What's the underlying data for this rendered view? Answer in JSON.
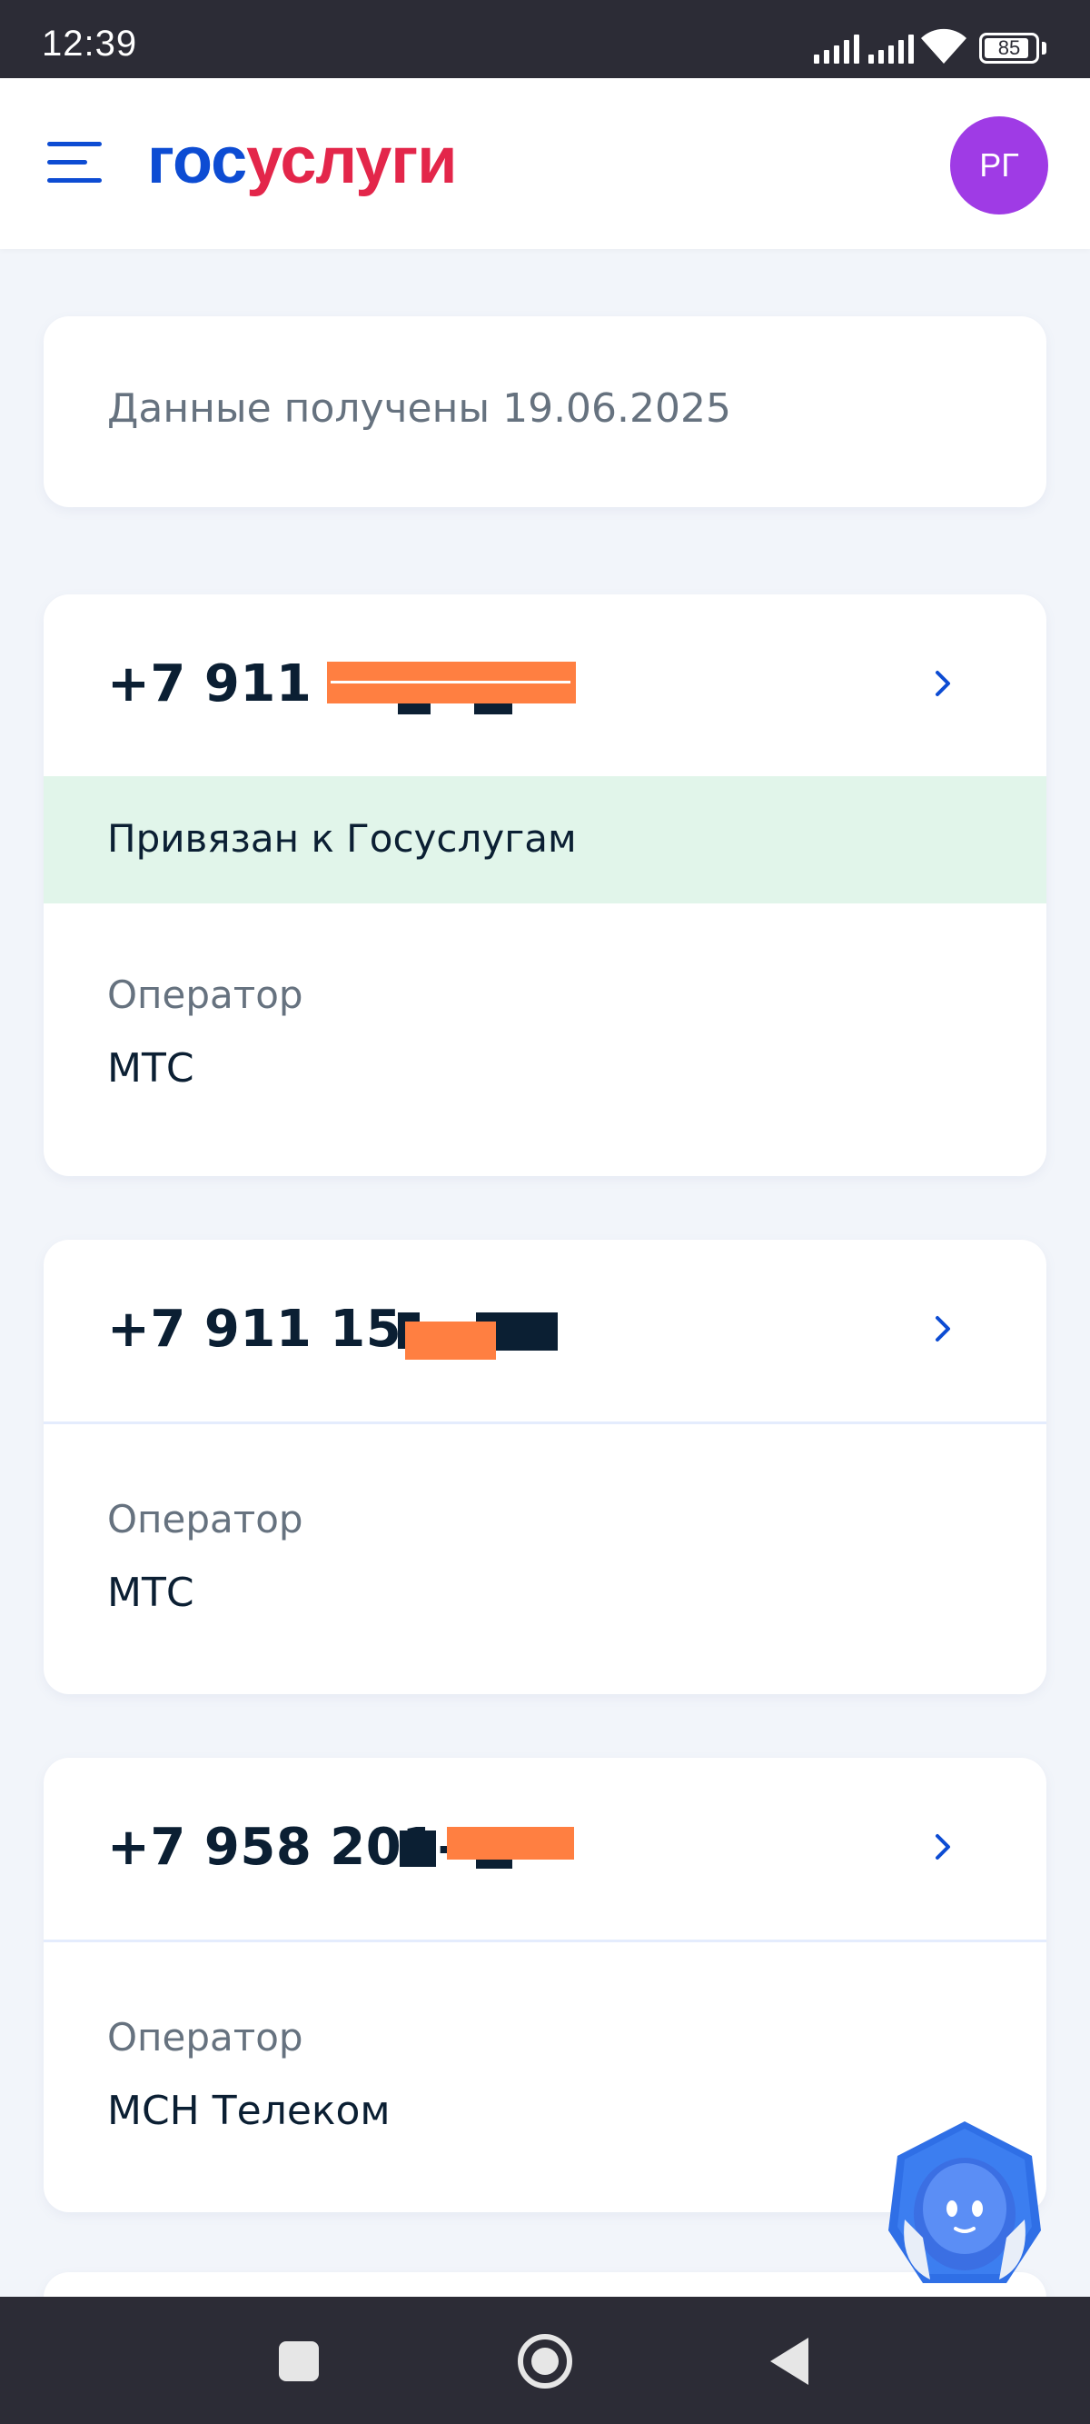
{
  "status_bar": {
    "time": "12:39",
    "battery": "85"
  },
  "header": {
    "logo_part1": "гос",
    "logo_part2": "услуги",
    "avatar_initials": "РГ",
    "brand_blue": "#0d4cd3",
    "brand_red": "#e3264a"
  },
  "info": {
    "received_text": "Данные получены 19.06.2025"
  },
  "phones": [
    {
      "number_visible": "+7 911 9",
      "linked_status": "Привязан к Госуслугам",
      "operator_label": "Оператор",
      "operator": "МТС"
    },
    {
      "number_visible": "+7 911 15",
      "operator_label": "Оператор",
      "operator": "МТС"
    },
    {
      "number_visible": "+7 958 201-",
      "operator_label": "Оператор",
      "operator": "МСН Телеком"
    }
  ],
  "icons": {
    "menu": "hamburger-menu-icon",
    "chevron": "chevron-right-icon",
    "assistant": "robot-assistant-icon"
  }
}
